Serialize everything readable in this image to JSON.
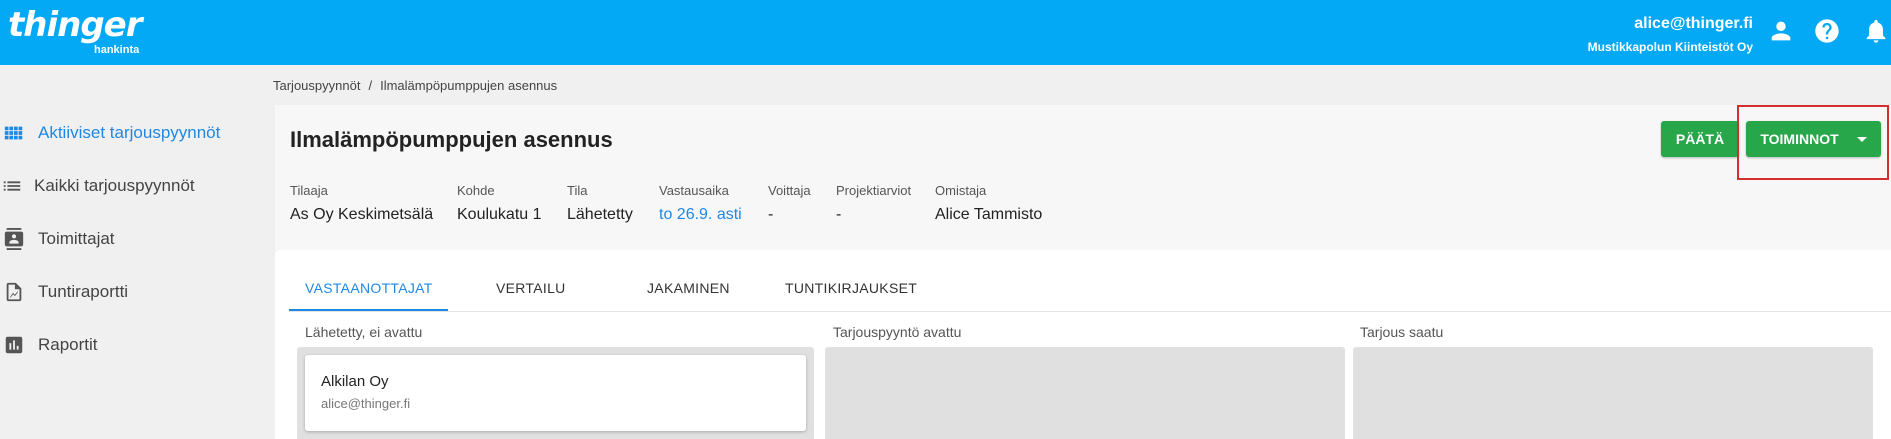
{
  "header": {
    "logo_text": "thinger",
    "logo_sub": "hankinta",
    "user_email": "alice@thinger.fi",
    "user_org": "Mustikkapolun Kiinteistöt Oy",
    "icons": [
      "account-icon",
      "help-icon",
      "bell-icon"
    ]
  },
  "sidebar": {
    "items": [
      {
        "label": "Aktiiviset tarjouspyynnöt",
        "icon": "grid-icon",
        "active": true
      },
      {
        "label": "Kaikki tarjouspyynnöt",
        "icon": "list-icon",
        "active": false
      },
      {
        "label": "Toimittajat",
        "icon": "contact-card-icon",
        "active": false
      },
      {
        "label": "Tuntiraportti",
        "icon": "report-chart-icon",
        "active": false
      },
      {
        "label": "Raportit",
        "icon": "bar-chart-icon",
        "active": false
      }
    ]
  },
  "breadcrumb": {
    "root": "Tarjouspyynnöt",
    "separator": "/",
    "current": "Ilmalämpöpumppujen asennus"
  },
  "request": {
    "title": "Ilmalämpöpumppujen asennus",
    "close_label": "PÄÄTÄ",
    "actions_label": "TOIMINNOT",
    "meta": [
      {
        "label": "Tilaaja",
        "value": "As Oy Keskimetsälä"
      },
      {
        "label": "Kohde",
        "value": "Koulukatu 1"
      },
      {
        "label": "Tila",
        "value": "Lähetetty"
      },
      {
        "label": "Vastausaika",
        "value": "to 26.9. asti"
      },
      {
        "label": "Voittaja",
        "value": "-"
      },
      {
        "label": "Projektiarviot",
        "value": "-"
      },
      {
        "label": "Omistaja",
        "value": "Alice Tammisto"
      }
    ]
  },
  "tabs": [
    {
      "label": "VASTAANOTTAJAT",
      "active": true
    },
    {
      "label": "VERTAILU",
      "active": false
    },
    {
      "label": "JAKAMINEN",
      "active": false
    },
    {
      "label": "TUNTIKIRJAUKSET",
      "active": false
    }
  ],
  "columns": [
    {
      "title": "Lähetetty, ei avattu",
      "cards": [
        {
          "name": "Alkilan Oy",
          "email": "alice@thinger.fi"
        }
      ]
    },
    {
      "title": "Tarjouspyyntö avattu",
      "cards": []
    },
    {
      "title": "Tarjous saatu",
      "cards": []
    }
  ],
  "colors": {
    "topbar": "#03a9f4",
    "accent": "#1e88e5",
    "button": "#27a74a",
    "focus_outline": "#d32f2f"
  }
}
